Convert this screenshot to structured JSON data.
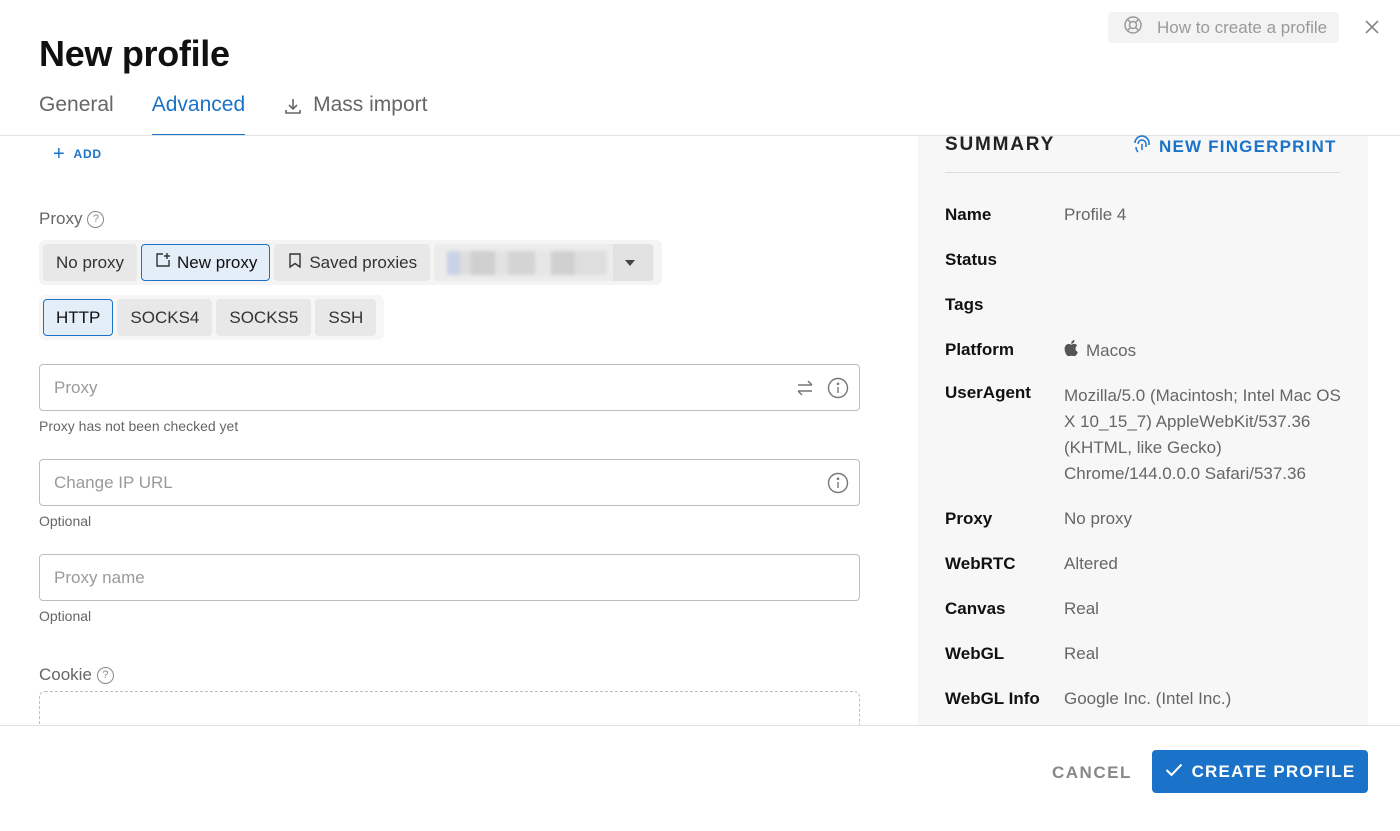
{
  "header": {
    "title": "New profile",
    "help_label": "How to create a profile",
    "help_icon": "lifebuoy-icon",
    "close_icon": "close-icon"
  },
  "tabs": [
    {
      "label": "General",
      "active": false
    },
    {
      "label": "Advanced",
      "active": true
    },
    {
      "label": "Mass import",
      "active": false,
      "icon": "download-icon"
    }
  ],
  "left": {
    "add_label": "ADD",
    "proxy_label": "Proxy",
    "proxy_modes": [
      {
        "label": "No proxy",
        "selected": false
      },
      {
        "label": "New proxy",
        "selected": true,
        "icon": "new-proxy-icon"
      },
      {
        "label": "Saved proxies",
        "selected": false,
        "icon": "bookmark-icon"
      }
    ],
    "protocols": [
      {
        "label": "HTTP",
        "selected": true
      },
      {
        "label": "SOCKS4",
        "selected": false
      },
      {
        "label": "SOCKS5",
        "selected": false
      },
      {
        "label": "SSH",
        "selected": false
      }
    ],
    "proxy_field": {
      "placeholder": "Proxy",
      "value": "",
      "helper": "Proxy has not been checked yet"
    },
    "change_ip_field": {
      "placeholder": "Change IP URL",
      "value": "",
      "helper": "Optional"
    },
    "proxy_name_field": {
      "placeholder": "Proxy name",
      "value": "",
      "helper": "Optional"
    },
    "cookie_label": "Cookie"
  },
  "summary": {
    "title": "SUMMARY",
    "fingerprint_label": "NEW FINGERPRINT",
    "rows": [
      {
        "key": "Name",
        "value": "Profile 4"
      },
      {
        "key": "Status",
        "value": ""
      },
      {
        "key": "Tags",
        "value": ""
      },
      {
        "key": "Platform",
        "value": "Macos"
      },
      {
        "key": "UserAgent",
        "value": "Mozilla/5.0 (Macintosh; Intel Mac OS X 10_15_7) AppleWebKit/537.36 (KHTML, like Gecko) Chrome/144.0.0.0 Safari/537.36"
      },
      {
        "key": "Proxy",
        "value": "No proxy"
      },
      {
        "key": "WebRTC",
        "value": "Altered"
      },
      {
        "key": "Canvas",
        "value": "Real"
      },
      {
        "key": "WebGL",
        "value": "Real"
      },
      {
        "key": "WebGL Info",
        "value": "Google Inc. (Intel Inc.)"
      }
    ]
  },
  "footer": {
    "cancel_label": "CANCEL",
    "create_label": "CREATE PROFILE"
  },
  "colors": {
    "accent": "#1a73c8",
    "muted": "#666666"
  }
}
